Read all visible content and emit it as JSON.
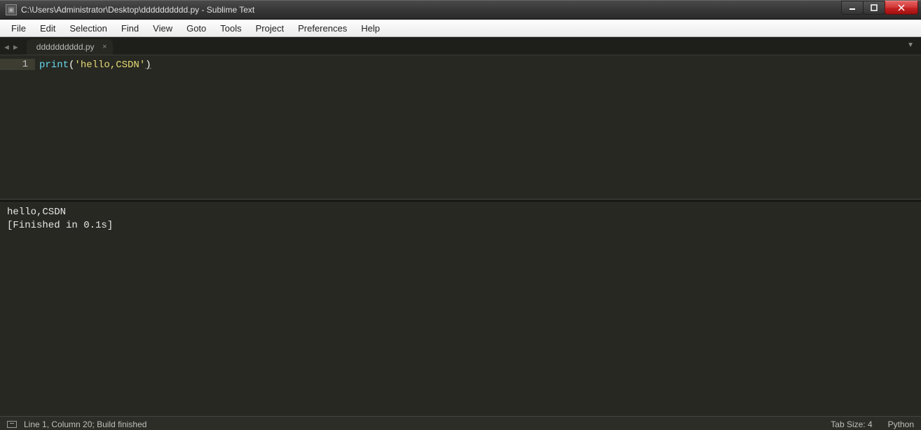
{
  "window": {
    "title": "C:\\Users\\Administrator\\Desktop\\dddddddddd.py - Sublime Text"
  },
  "menu": {
    "items": [
      "File",
      "Edit",
      "Selection",
      "Find",
      "View",
      "Goto",
      "Tools",
      "Project",
      "Preferences",
      "Help"
    ]
  },
  "tabs": {
    "active": "dddddddddd.py"
  },
  "editor": {
    "line_number": "1",
    "tokens": {
      "func": "print",
      "open": "(",
      "str": "'hello,CSDN'",
      "close": ")"
    }
  },
  "console": {
    "line1": "hello,CSDN",
    "line2": "[Finished in 0.1s]"
  },
  "status": {
    "left": "Line 1, Column 20; Build finished",
    "tab_size": "Tab Size: 4",
    "syntax": "Python"
  }
}
